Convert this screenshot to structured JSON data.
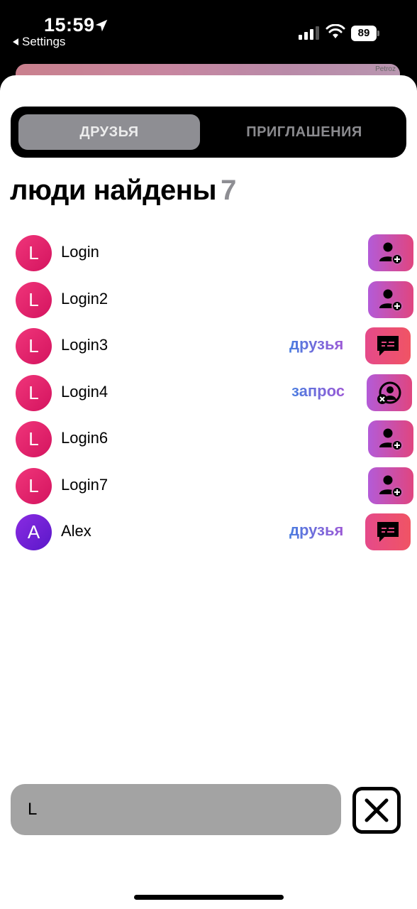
{
  "status_bar": {
    "time": "15:59",
    "back_label": "Settings",
    "battery": "89"
  },
  "map": {
    "label": "Petroz"
  },
  "tabs": [
    {
      "label": "ДРУЗЬЯ",
      "active": true
    },
    {
      "label": "ПРИГЛАШЕНИЯ",
      "active": false
    }
  ],
  "header": {
    "title": "люди найдены",
    "count": "7"
  },
  "users": [
    {
      "initial": "L",
      "name": "Login",
      "status": "",
      "action": "add-friend-icon"
    },
    {
      "initial": "L",
      "name": "Login2",
      "status": "",
      "action": "add-friend-icon"
    },
    {
      "initial": "L",
      "name": "Login3",
      "status": "друзья",
      "action": "message-icon"
    },
    {
      "initial": "L",
      "name": "Login4",
      "status": "запрос",
      "action": "cancel-request-icon"
    },
    {
      "initial": "L",
      "name": "Login6",
      "status": "",
      "action": "add-friend-icon"
    },
    {
      "initial": "L",
      "name": "Login7",
      "status": "",
      "action": "add-friend-icon"
    },
    {
      "initial": "A",
      "name": "Alex",
      "status": "друзья",
      "action": "message-icon"
    }
  ],
  "search": {
    "value": "L"
  },
  "colors": {
    "accent_pink": "#e0457f",
    "accent_purple": "#b35bd8",
    "avatar_pink": "#e8236e",
    "avatar_purple": "#7b22d8",
    "status_text_blue": "#4a7de0"
  }
}
